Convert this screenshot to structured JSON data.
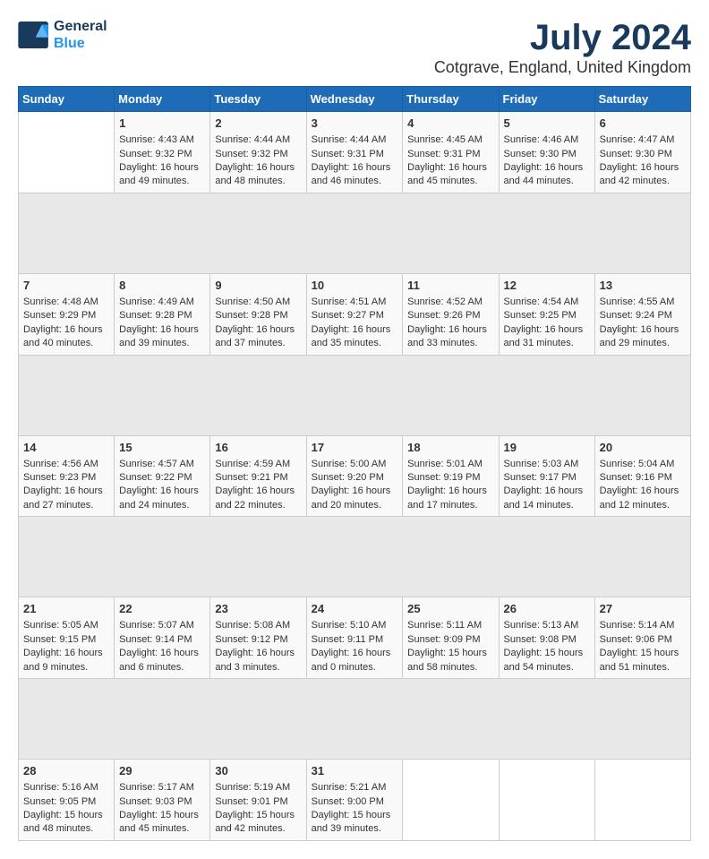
{
  "logo": {
    "line1": "General",
    "line2": "Blue"
  },
  "title": "July 2024",
  "subtitle": "Cotgrave, England, United Kingdom",
  "headers": [
    "Sunday",
    "Monday",
    "Tuesday",
    "Wednesday",
    "Thursday",
    "Friday",
    "Saturday"
  ],
  "weeks": [
    [
      {
        "day": "",
        "text": ""
      },
      {
        "day": "1",
        "text": "Sunrise: 4:43 AM\nSunset: 9:32 PM\nDaylight: 16 hours\nand 49 minutes."
      },
      {
        "day": "2",
        "text": "Sunrise: 4:44 AM\nSunset: 9:32 PM\nDaylight: 16 hours\nand 48 minutes."
      },
      {
        "day": "3",
        "text": "Sunrise: 4:44 AM\nSunset: 9:31 PM\nDaylight: 16 hours\nand 46 minutes."
      },
      {
        "day": "4",
        "text": "Sunrise: 4:45 AM\nSunset: 9:31 PM\nDaylight: 16 hours\nand 45 minutes."
      },
      {
        "day": "5",
        "text": "Sunrise: 4:46 AM\nSunset: 9:30 PM\nDaylight: 16 hours\nand 44 minutes."
      },
      {
        "day": "6",
        "text": "Sunrise: 4:47 AM\nSunset: 9:30 PM\nDaylight: 16 hours\nand 42 minutes."
      }
    ],
    [
      {
        "day": "7",
        "text": "Sunrise: 4:48 AM\nSunset: 9:29 PM\nDaylight: 16 hours\nand 40 minutes."
      },
      {
        "day": "8",
        "text": "Sunrise: 4:49 AM\nSunset: 9:28 PM\nDaylight: 16 hours\nand 39 minutes."
      },
      {
        "day": "9",
        "text": "Sunrise: 4:50 AM\nSunset: 9:28 PM\nDaylight: 16 hours\nand 37 minutes."
      },
      {
        "day": "10",
        "text": "Sunrise: 4:51 AM\nSunset: 9:27 PM\nDaylight: 16 hours\nand 35 minutes."
      },
      {
        "day": "11",
        "text": "Sunrise: 4:52 AM\nSunset: 9:26 PM\nDaylight: 16 hours\nand 33 minutes."
      },
      {
        "day": "12",
        "text": "Sunrise: 4:54 AM\nSunset: 9:25 PM\nDaylight: 16 hours\nand 31 minutes."
      },
      {
        "day": "13",
        "text": "Sunrise: 4:55 AM\nSunset: 9:24 PM\nDaylight: 16 hours\nand 29 minutes."
      }
    ],
    [
      {
        "day": "14",
        "text": "Sunrise: 4:56 AM\nSunset: 9:23 PM\nDaylight: 16 hours\nand 27 minutes."
      },
      {
        "day": "15",
        "text": "Sunrise: 4:57 AM\nSunset: 9:22 PM\nDaylight: 16 hours\nand 24 minutes."
      },
      {
        "day": "16",
        "text": "Sunrise: 4:59 AM\nSunset: 9:21 PM\nDaylight: 16 hours\nand 22 minutes."
      },
      {
        "day": "17",
        "text": "Sunrise: 5:00 AM\nSunset: 9:20 PM\nDaylight: 16 hours\nand 20 minutes."
      },
      {
        "day": "18",
        "text": "Sunrise: 5:01 AM\nSunset: 9:19 PM\nDaylight: 16 hours\nand 17 minutes."
      },
      {
        "day": "19",
        "text": "Sunrise: 5:03 AM\nSunset: 9:17 PM\nDaylight: 16 hours\nand 14 minutes."
      },
      {
        "day": "20",
        "text": "Sunrise: 5:04 AM\nSunset: 9:16 PM\nDaylight: 16 hours\nand 12 minutes."
      }
    ],
    [
      {
        "day": "21",
        "text": "Sunrise: 5:05 AM\nSunset: 9:15 PM\nDaylight: 16 hours\nand 9 minutes."
      },
      {
        "day": "22",
        "text": "Sunrise: 5:07 AM\nSunset: 9:14 PM\nDaylight: 16 hours\nand 6 minutes."
      },
      {
        "day": "23",
        "text": "Sunrise: 5:08 AM\nSunset: 9:12 PM\nDaylight: 16 hours\nand 3 minutes."
      },
      {
        "day": "24",
        "text": "Sunrise: 5:10 AM\nSunset: 9:11 PM\nDaylight: 16 hours\nand 0 minutes."
      },
      {
        "day": "25",
        "text": "Sunrise: 5:11 AM\nSunset: 9:09 PM\nDaylight: 15 hours\nand 58 minutes."
      },
      {
        "day": "26",
        "text": "Sunrise: 5:13 AM\nSunset: 9:08 PM\nDaylight: 15 hours\nand 54 minutes."
      },
      {
        "day": "27",
        "text": "Sunrise: 5:14 AM\nSunset: 9:06 PM\nDaylight: 15 hours\nand 51 minutes."
      }
    ],
    [
      {
        "day": "28",
        "text": "Sunrise: 5:16 AM\nSunset: 9:05 PM\nDaylight: 15 hours\nand 48 minutes."
      },
      {
        "day": "29",
        "text": "Sunrise: 5:17 AM\nSunset: 9:03 PM\nDaylight: 15 hours\nand 45 minutes."
      },
      {
        "day": "30",
        "text": "Sunrise: 5:19 AM\nSunset: 9:01 PM\nDaylight: 15 hours\nand 42 minutes."
      },
      {
        "day": "31",
        "text": "Sunrise: 5:21 AM\nSunset: 9:00 PM\nDaylight: 15 hours\nand 39 minutes."
      },
      {
        "day": "",
        "text": ""
      },
      {
        "day": "",
        "text": ""
      },
      {
        "day": "",
        "text": ""
      }
    ]
  ]
}
